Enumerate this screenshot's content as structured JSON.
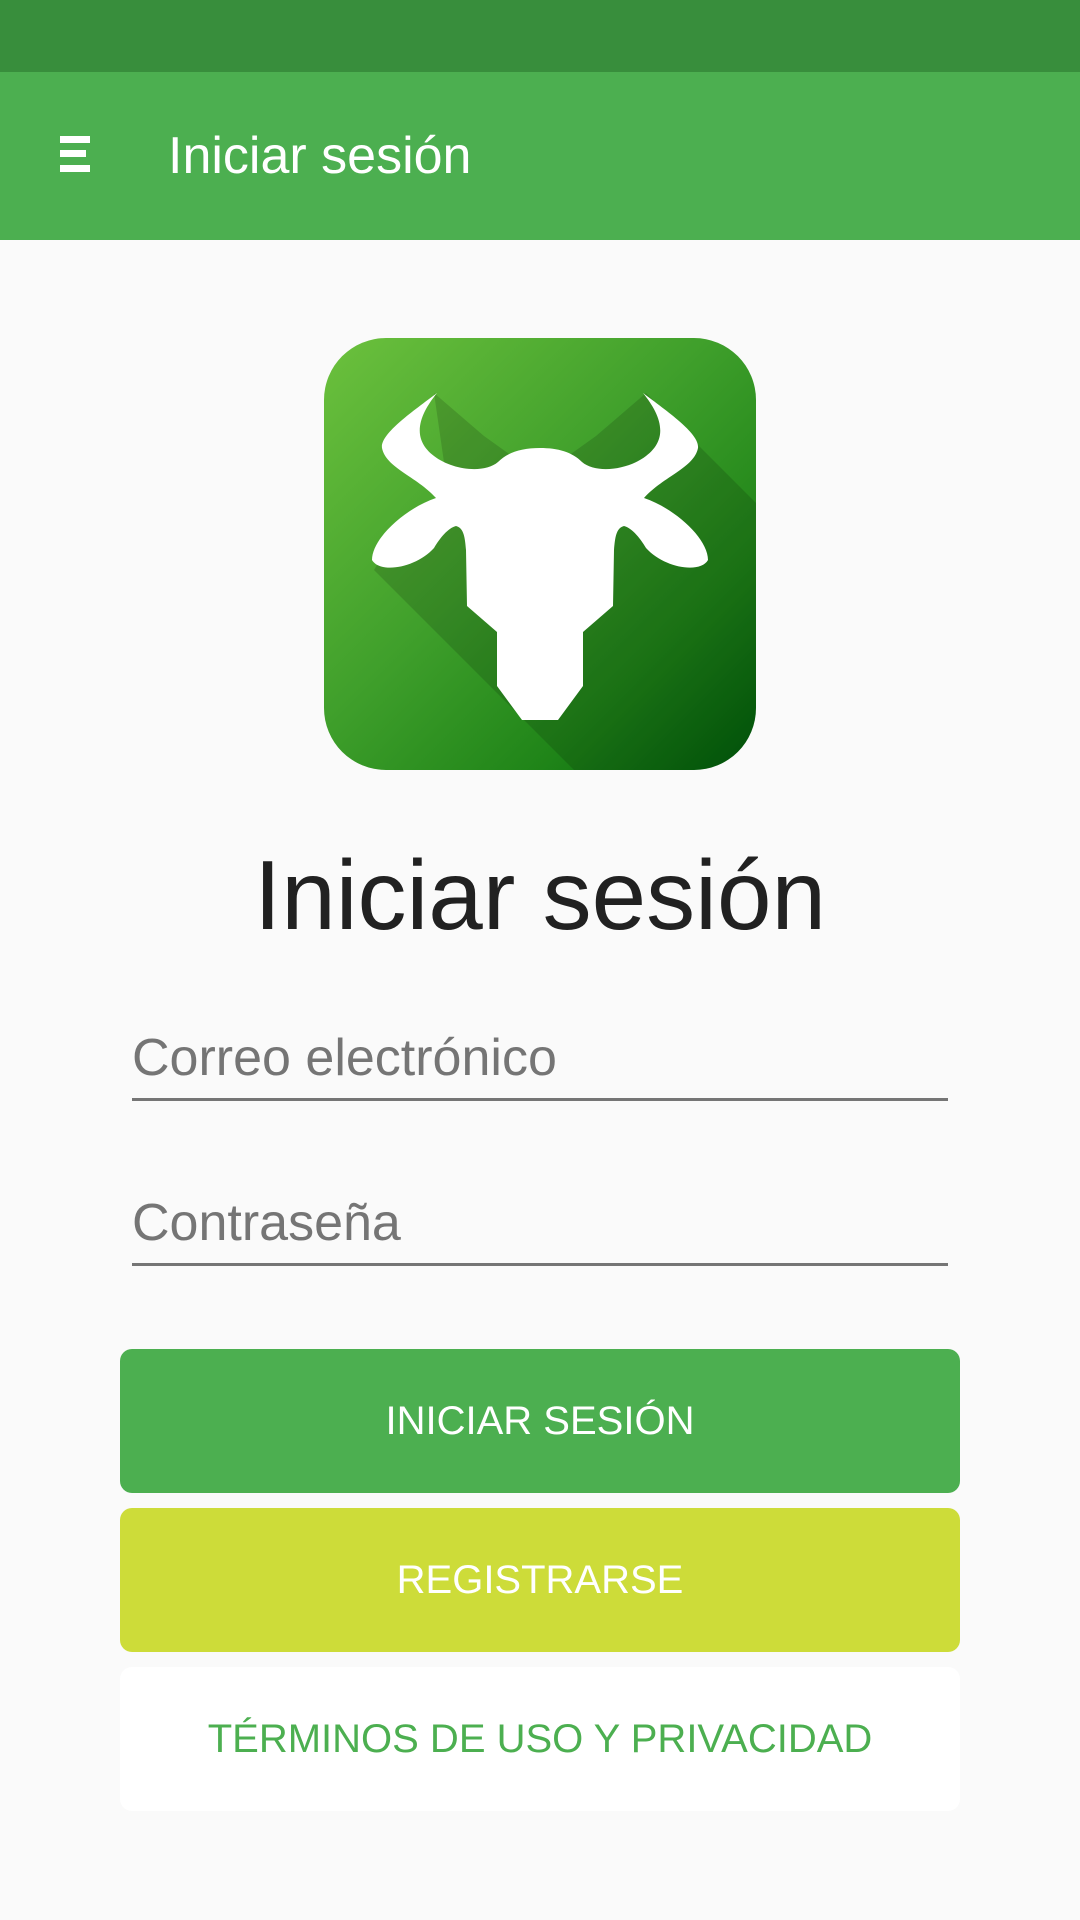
{
  "app_bar": {
    "title": "Iniciar sesión",
    "menu_icon": "hamburger-menu-icon"
  },
  "logo": {
    "icon": "bull-head-icon",
    "colors": {
      "gradient_start": "#6cc13d",
      "gradient_end": "#005e0b",
      "glyph": "#ffffff"
    }
  },
  "heading": "Iniciar sesión",
  "form": {
    "email_placeholder": "Correo electrónico",
    "email_value": "",
    "password_placeholder": "Contraseña",
    "password_value": ""
  },
  "buttons": {
    "login_label": "INICIAR SESIÓN",
    "register_label": "REGISTRARSE",
    "terms_label": "TÉRMINOS DE USO Y PRIVACIDAD"
  },
  "colors": {
    "status_bar": "#388e3c",
    "primary": "#4caf50",
    "accent_lime": "#cddc39",
    "background": "#fafafa"
  }
}
